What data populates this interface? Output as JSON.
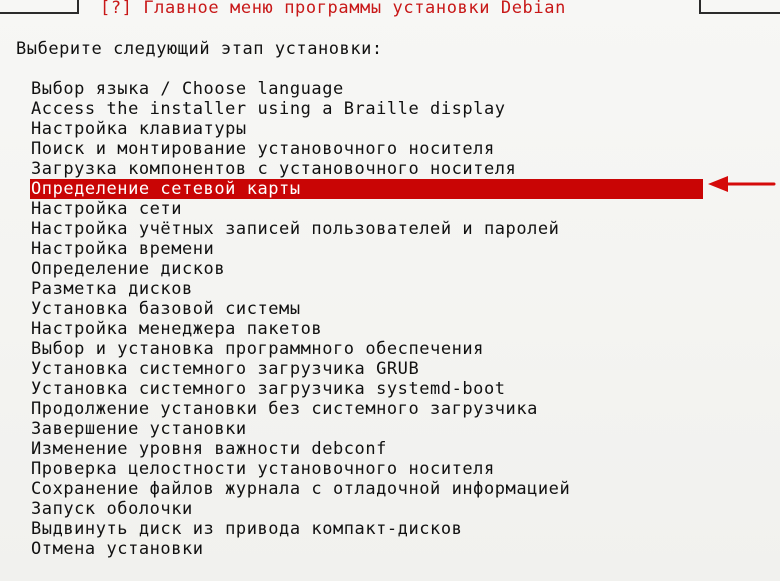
{
  "window": {
    "title": "[?] Главное меню программы установки Debian"
  },
  "prompt": "Выберите следующий этап установки:",
  "menu": {
    "items": [
      {
        "label": "Выбор языка / Choose language"
      },
      {
        "label": "Access the installer using a Braille display"
      },
      {
        "label": "Настройка клавиатуры"
      },
      {
        "label": "Поиск и монтирование установочного носителя"
      },
      {
        "label": "Загрузка компонентов с установочного носителя"
      },
      {
        "label": "Определение сетевой карты",
        "selected": true
      },
      {
        "label": "Настройка сети"
      },
      {
        "label": "Настройка учётных записей пользователей и паролей"
      },
      {
        "label": "Настройка времени"
      },
      {
        "label": "Определение дисков"
      },
      {
        "label": "Разметка дисков"
      },
      {
        "label": "Установка базовой системы"
      },
      {
        "label": "Настройка менеджера пакетов"
      },
      {
        "label": "Выбор и установка программного обеспечения"
      },
      {
        "label": "Установка системного загрузчика GRUB"
      },
      {
        "label": "Установка системного загрузчика systemd-boot"
      },
      {
        "label": "Продолжение установки без системного загрузчика"
      },
      {
        "label": "Завершение установки"
      },
      {
        "label": "Изменение уровня важности debconf"
      },
      {
        "label": "Проверка целостности установочного носителя"
      },
      {
        "label": "Сохранение файлов журнала с отладочной информацией"
      },
      {
        "label": "Запуск оболочки"
      },
      {
        "label": "Выдвинуть диск из привода компакт-дисков"
      },
      {
        "label": "Отмена установки"
      }
    ]
  },
  "colors": {
    "title_text": "#c81818",
    "selection_background": "#c90505",
    "selection_text": "#ffffff",
    "arrow": "#d50a0a"
  },
  "icons": {
    "annotation": "left-arrow-icon"
  }
}
